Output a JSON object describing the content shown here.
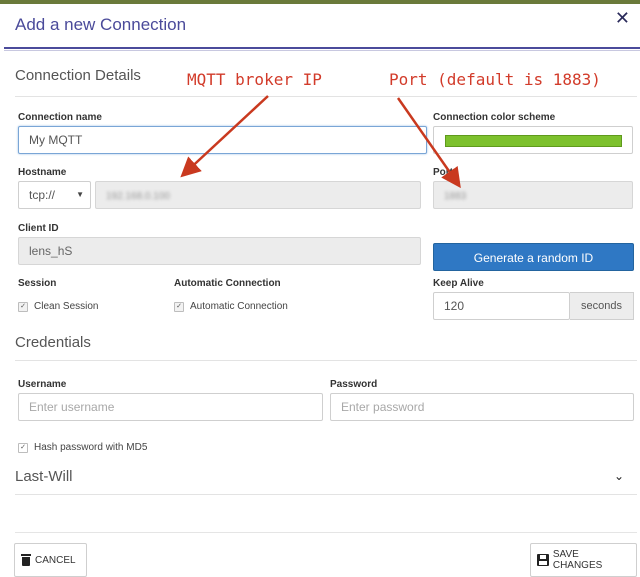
{
  "dialog": {
    "title": "Add a new Connection"
  },
  "annotations": {
    "broker_ip": "MQTT broker IP",
    "port": "Port (default is 1883)"
  },
  "connection_details": {
    "heading": "Connection Details",
    "name": {
      "label": "Connection name",
      "value": "My MQTT"
    },
    "color_scheme": {
      "label": "Connection color scheme",
      "color": "#7dc12d"
    },
    "hostname": {
      "label": "Hostname",
      "protocol": "tcp://",
      "value": "192.168.0.100"
    },
    "port": {
      "label": "Port",
      "value": "1883"
    },
    "client_id": {
      "label": "Client ID",
      "value": "lens_hS"
    },
    "generate_button": "Generate a random ID",
    "session": {
      "label": "Session",
      "option": "Clean Session"
    },
    "auto_connection": {
      "label": "Automatic Connection",
      "option": "Automatic Connection"
    },
    "keep_alive": {
      "label": "Keep Alive",
      "value": "120",
      "unit": "seconds"
    }
  },
  "credentials": {
    "heading": "Credentials",
    "username": {
      "label": "Username",
      "placeholder": "Enter username"
    },
    "password": {
      "label": "Password",
      "placeholder": "Enter password"
    },
    "hash_md5": "Hash password with MD5"
  },
  "last_will": {
    "heading": "Last-Will"
  },
  "footer": {
    "cancel": "CANCEL",
    "save": "SAVE CHANGES"
  },
  "colors": {
    "accent": "#2f78c4",
    "annotation": "#d23b2a",
    "header_rule": "#4b4b9b"
  }
}
